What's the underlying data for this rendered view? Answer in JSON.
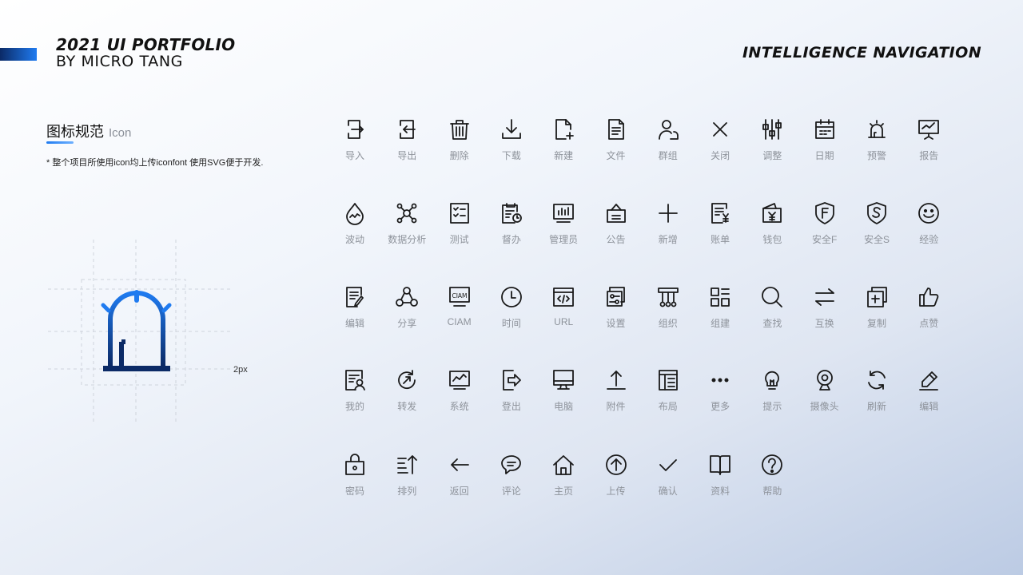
{
  "header": {
    "title": "2021 UI PORTFOLIO",
    "subtitle": "BY MICRO TANG",
    "project": "INTELLIGENCE NAVIGATION"
  },
  "section": {
    "title_cn": "图标规范",
    "title_en": "Icon",
    "note": "* 整个项目所使用icon均上传iconfont 使用SVG便于开发."
  },
  "spec": {
    "stroke_label": "2px",
    "icon": "alarm-icon",
    "colors": {
      "gradient_start": "#1f7bf0",
      "gradient_end": "#0b2a66",
      "grid": "#cfd4dc"
    }
  },
  "colors": {
    "icon_stroke": "#1a1a1a",
    "label": "#8e939b",
    "accent": "#1f7bf0"
  },
  "icons": [
    {
      "label": "导入",
      "icon": "import-icon"
    },
    {
      "label": "导出",
      "icon": "export-icon"
    },
    {
      "label": "删除",
      "icon": "delete-icon"
    },
    {
      "label": "下载",
      "icon": "download-icon"
    },
    {
      "label": "新建",
      "icon": "new-file-icon"
    },
    {
      "label": "文件",
      "icon": "file-icon"
    },
    {
      "label": "群组",
      "icon": "group-icon"
    },
    {
      "label": "关闭",
      "icon": "close-icon"
    },
    {
      "label": "调整",
      "icon": "adjust-icon"
    },
    {
      "label": "日期",
      "icon": "calendar-icon"
    },
    {
      "label": "预警",
      "icon": "alarm-icon"
    },
    {
      "label": "报告",
      "icon": "report-icon"
    },
    {
      "label": "波动",
      "icon": "fluctuation-icon"
    },
    {
      "label": "数据分析",
      "icon": "data-analysis-icon"
    },
    {
      "label": "测试",
      "icon": "test-icon"
    },
    {
      "label": "督办",
      "icon": "supervise-icon"
    },
    {
      "label": "管理员",
      "icon": "admin-icon"
    },
    {
      "label": "公告",
      "icon": "notice-icon"
    },
    {
      "label": "新增",
      "icon": "plus-icon"
    },
    {
      "label": "账单",
      "icon": "bill-icon"
    },
    {
      "label": "钱包",
      "icon": "wallet-icon"
    },
    {
      "label": "安全F",
      "icon": "shield-f-icon"
    },
    {
      "label": "安全S",
      "icon": "shield-s-icon"
    },
    {
      "label": "经验",
      "icon": "smile-icon"
    },
    {
      "label": "编辑",
      "icon": "edit-doc-icon"
    },
    {
      "label": "分享",
      "icon": "share-icon"
    },
    {
      "label": "CIAM",
      "icon": "ciam-icon",
      "text": "CIAM"
    },
    {
      "label": "时间",
      "icon": "clock-icon"
    },
    {
      "label": "URL",
      "icon": "url-icon"
    },
    {
      "label": "设置",
      "icon": "settings-icon"
    },
    {
      "label": "组织",
      "icon": "organization-icon"
    },
    {
      "label": "组建",
      "icon": "grid-icon"
    },
    {
      "label": "查找",
      "icon": "search-icon"
    },
    {
      "label": "互换",
      "icon": "swap-icon"
    },
    {
      "label": "复制",
      "icon": "copy-icon"
    },
    {
      "label": "点赞",
      "icon": "thumbs-up-icon"
    },
    {
      "label": "我的",
      "icon": "profile-icon"
    },
    {
      "label": "转发",
      "icon": "forward-icon"
    },
    {
      "label": "系统",
      "icon": "system-icon"
    },
    {
      "label": "登出",
      "icon": "logout-icon"
    },
    {
      "label": "电脑",
      "icon": "computer-icon"
    },
    {
      "label": "附件",
      "icon": "upload-attachment-icon"
    },
    {
      "label": "布局",
      "icon": "layout-icon"
    },
    {
      "label": "更多",
      "icon": "more-icon"
    },
    {
      "label": "提示",
      "icon": "bulb-icon"
    },
    {
      "label": "摄像头",
      "icon": "webcam-icon"
    },
    {
      "label": "刷新",
      "icon": "refresh-icon"
    },
    {
      "label": "编辑",
      "icon": "pencil-icon"
    },
    {
      "label": "密码",
      "icon": "password-icon"
    },
    {
      "label": "排列",
      "icon": "sort-icon"
    },
    {
      "label": "返回",
      "icon": "back-arrow-icon"
    },
    {
      "label": "评论",
      "icon": "comment-icon"
    },
    {
      "label": "主页",
      "icon": "home-icon"
    },
    {
      "label": "上传",
      "icon": "upload-circle-icon"
    },
    {
      "label": "确认",
      "icon": "check-icon"
    },
    {
      "label": "资料",
      "icon": "book-icon"
    },
    {
      "label": "帮助",
      "icon": "help-icon"
    }
  ]
}
